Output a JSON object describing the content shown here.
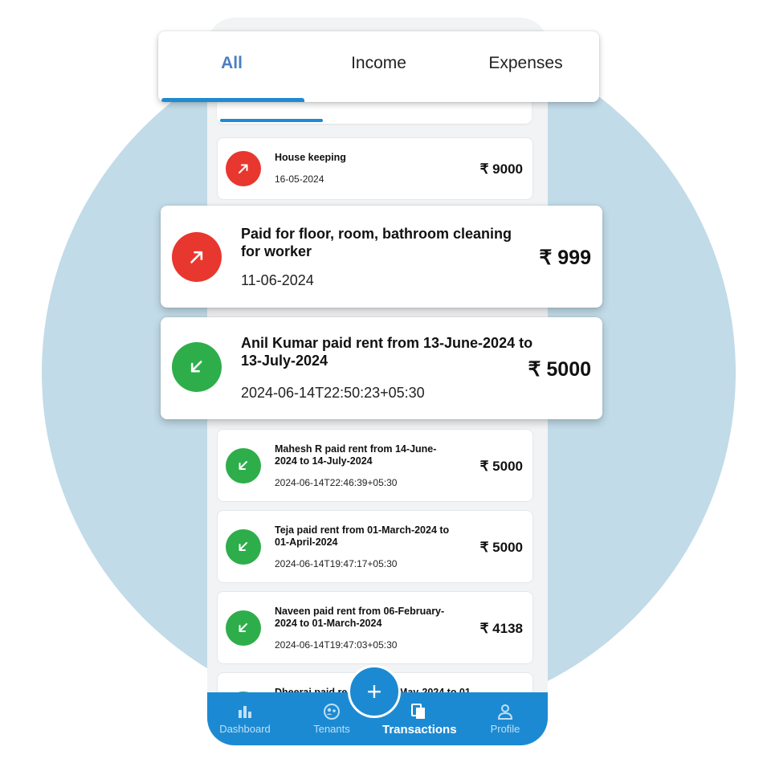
{
  "tabs": [
    {
      "label": "All",
      "active": true
    },
    {
      "label": "Income",
      "active": false
    },
    {
      "label": "Expenses",
      "active": false
    }
  ],
  "transactions": [
    {
      "title": "House keeping",
      "date": "16-05-2024",
      "amount": "₹ 9000",
      "type": "expense"
    },
    {
      "title": "Paid for floor, room, bathroom cleaning for worker",
      "date": "11-06-2024",
      "amount": "₹ 999",
      "type": "expense"
    },
    {
      "title": "Anil Kumar paid rent from 13-June-2024 to 13-July-2024",
      "date": "2024-06-14T22:50:23+05:30",
      "amount": "₹ 5000",
      "type": "income"
    },
    {
      "title": "Mahesh R paid rent from 14-June-2024 to 14-July-2024",
      "date": "2024-06-14T22:46:39+05:30",
      "amount": "₹ 5000",
      "type": "income"
    },
    {
      "title": "Teja paid rent from 01-March-2024 to 01-April-2024",
      "date": "2024-06-14T19:47:17+05:30",
      "amount": "₹ 5000",
      "type": "income"
    },
    {
      "title": "Naveen paid rent from 06-February-2024 to 01-March-2024",
      "date": "2024-06-14T19:47:03+05:30",
      "amount": "₹ 4138",
      "type": "income"
    },
    {
      "title": "Dheeraj paid rent from 01-May-2024 to 01-",
      "date": "",
      "amount": "",
      "type": "income"
    }
  ],
  "fab": {
    "label": "+"
  },
  "nav": [
    {
      "label": "Dashboard",
      "icon": "bar-chart-icon",
      "active": false
    },
    {
      "label": "Tenants",
      "icon": "tenants-icon",
      "active": false
    },
    {
      "label": "Transactions",
      "icon": "documents-icon",
      "active": true
    },
    {
      "label": "Profile",
      "icon": "person-icon",
      "active": false
    }
  ],
  "colors": {
    "accent": "#1c8ad3",
    "expense": "#e8372e",
    "income": "#2eae4a",
    "active_tab": "#4a7fc1",
    "background_circle": "#c1dbe8"
  }
}
